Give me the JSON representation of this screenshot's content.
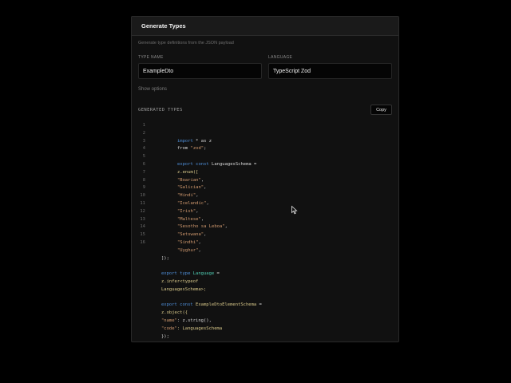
{
  "panel": {
    "title": "Generate Types",
    "description": "Generate type definitions from the JSON payload"
  },
  "form": {
    "type_name": {
      "label": "TYPE NAME",
      "value": "ExampleDto"
    },
    "language": {
      "label": "LANGUAGE",
      "value": "TypeScript Zod"
    },
    "options_link": "Show options"
  },
  "output": {
    "label": "GENERATED TYPES",
    "copy_label": "Copy"
  },
  "code": {
    "line_numbers": [
      "1",
      "2",
      "3",
      "4",
      "5",
      "6",
      "7",
      "8",
      "9",
      "10",
      "11",
      "12",
      "13",
      "14",
      "15",
      "16"
    ],
    "lines": [
      [],
      [],
      [
        {
          "t": "import",
          "c": "kw"
        },
        {
          "t": " * as z",
          "c": "id"
        }
      ],
      [
        {
          "t": "from ",
          "c": "id"
        },
        {
          "t": "\"zod\"",
          "c": "str"
        },
        {
          "t": ";",
          "c": "id"
        }
      ],
      [],
      [
        {
          "t": "export const ",
          "c": "kw"
        },
        {
          "t": "LanguagesSchema",
          "c": "id"
        },
        {
          "t": " =",
          "c": "id"
        }
      ],
      [
        {
          "t": "z.enum([",
          "c": "fn"
        }
      ],
      [
        {
          "t": "\"Boarian\"",
          "c": "str"
        },
        {
          "t": ",",
          "c": "id"
        }
      ],
      [
        {
          "t": "\"Galician\"",
          "c": "str"
        },
        {
          "t": ",",
          "c": "id"
        }
      ],
      [
        {
          "t": "\"Hindi\"",
          "c": "str"
        },
        {
          "t": ",",
          "c": "id"
        }
      ],
      [
        {
          "t": "\"Icelandic\"",
          "c": "str"
        },
        {
          "t": ",",
          "c": "id"
        }
      ],
      [
        {
          "t": "\"Irish\"",
          "c": "str"
        },
        {
          "t": ",",
          "c": "id"
        }
      ],
      [
        {
          "t": "\"Maltese\"",
          "c": "str"
        },
        {
          "t": ",",
          "c": "id"
        }
      ],
      [
        {
          "t": "\"Sesotho sa Leboa\"",
          "c": "str"
        },
        {
          "t": ",",
          "c": "id"
        }
      ],
      [
        {
          "t": "\"Setswana\"",
          "c": "str"
        },
        {
          "t": ",",
          "c": "id"
        }
      ],
      [
        {
          "t": "\"Sindhi\"",
          "c": "str"
        },
        {
          "t": ",",
          "c": "id"
        }
      ],
      [
        {
          "t": "\"Uyghur\"",
          "c": "str"
        },
        {
          "t": ",",
          "c": "id"
        }
      ],
      [
        {
          "t": "]);",
          "c": "id"
        }
      ],
      [],
      [
        {
          "t": "export type ",
          "c": "kw"
        },
        {
          "t": "Language",
          "c": "ty"
        },
        {
          "t": " =",
          "c": "id"
        }
      ],
      [
        {
          "t": "z.infer<typeof",
          "c": "fn"
        }
      ],
      [
        {
          "t": "LanguagesSchema>;",
          "c": "fn"
        }
      ],
      [],
      [
        {
          "t": "export const ",
          "c": "kw"
        },
        {
          "t": "ExampleDtoElementSchema",
          "c": "fn"
        },
        {
          "t": " =",
          "c": "id"
        }
      ],
      [
        {
          "t": "z.object({",
          "c": "fn"
        }
      ],
      [
        {
          "t": "\"name\"",
          "c": "str"
        },
        {
          "t": ": z.string(),",
          "c": "id"
        }
      ],
      [
        {
          "t": "\"code\"",
          "c": "str"
        },
        {
          "t": ": LanguagesSchema",
          "c": "fn"
        }
      ],
      [
        {
          "t": "});",
          "c": "id"
        }
      ]
    ]
  },
  "colors": {
    "background": "#000000",
    "panel": "#111111",
    "keyword": "#4f8fd9",
    "string": "#d29a6f",
    "function": "#d8c88a",
    "type": "#4ec9b0"
  }
}
